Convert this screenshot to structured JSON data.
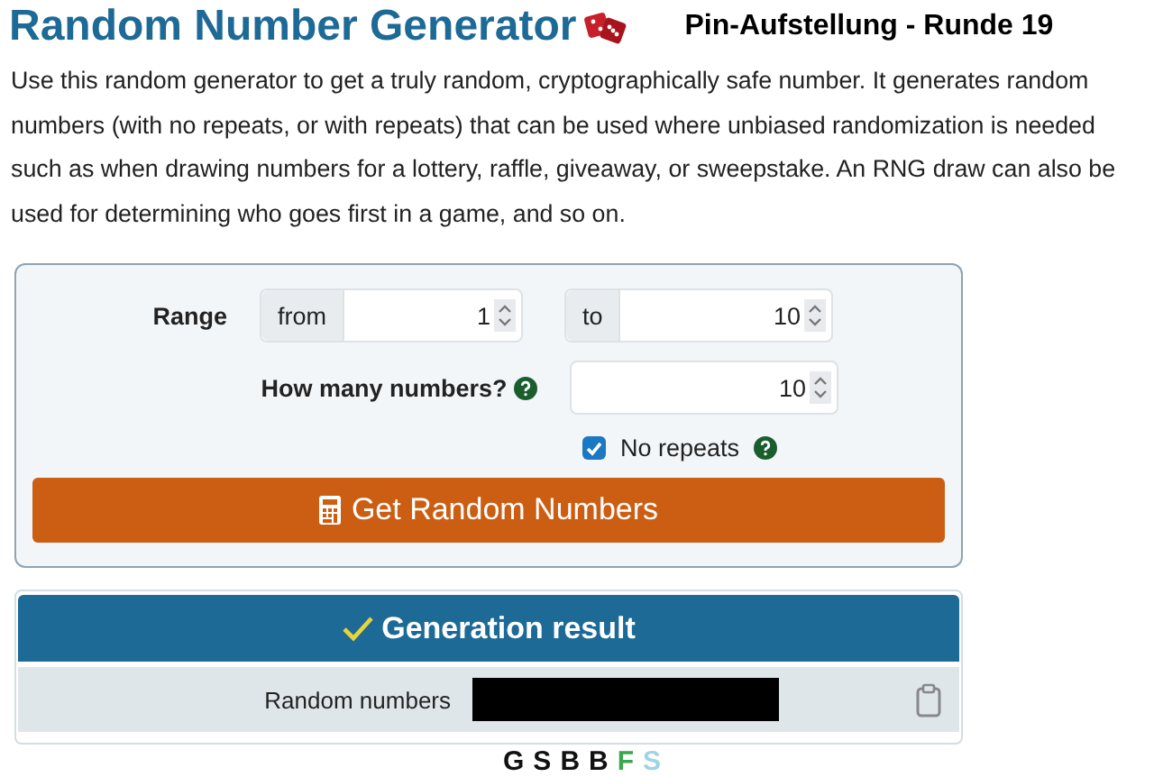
{
  "header": {
    "title": "Random Number Generator",
    "overlay_caption": "Pin-Aufstellung - Runde 19"
  },
  "description": "Use this random generator to get a truly random, cryptographically safe number. It generates random numbers (with no repeats, or with repeats) that can be used where unbiased randomization is needed such as when drawing numbers for a lottery, raffle, giveaway, or sweepstake. An RNG draw can also be used for determining who goes first in a game, and so on.",
  "form": {
    "range_label": "Range",
    "from_label": "from",
    "from_value": "1",
    "to_label": "to",
    "to_value": "10",
    "count_label": "How many numbers?",
    "count_value": "10",
    "no_repeats": {
      "label": "No repeats",
      "checked": true
    },
    "submit": "Get Random Numbers"
  },
  "result": {
    "title": "Generation result",
    "label": "Random numbers",
    "redacted": true
  },
  "letters": [
    {
      "text": "G",
      "color": "#111111"
    },
    {
      "text": "S",
      "color": "#111111"
    },
    {
      "text": "B",
      "color": "#111111"
    },
    {
      "text": "B",
      "color": "#111111"
    },
    {
      "text": "F",
      "color": "#3aa84a"
    },
    {
      "text": "S",
      "color": "#9fd4e4"
    }
  ]
}
